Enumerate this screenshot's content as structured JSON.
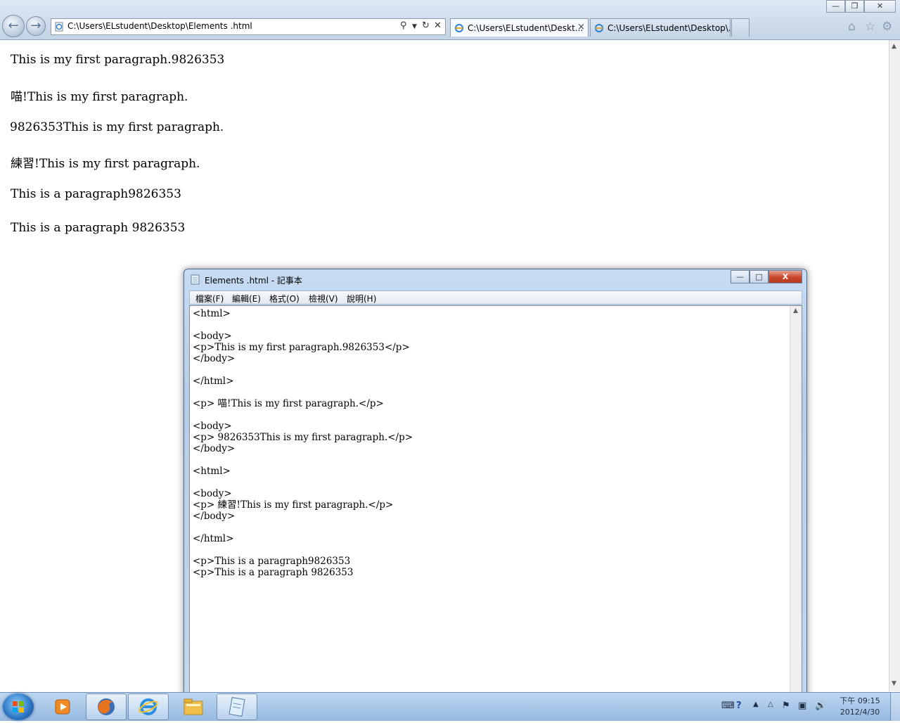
{
  "browser": {
    "address": "C:\\Users\\ELstudent\\Desktop\\Elements .html",
    "tabs": [
      {
        "label": "C:\\Users\\ELstudent\\Deskt..."
      },
      {
        "label": "C:\\Users\\ELstudent\\Desktop\\..."
      }
    ],
    "tab_close_symbol": "×",
    "toolbar_icons": [
      "home-icon",
      "favorites-star-icon",
      "tools-gear-icon"
    ],
    "window_controls": {
      "minimize": "—",
      "restore": "❐",
      "close": "✕"
    }
  },
  "page": {
    "paragraphs": [
      "This is my first paragraph.9826353",
      "喵!This is my first paragraph.",
      "9826353This is my first paragraph.",
      "練習!This is my first paragraph.",
      "This is a paragraph9826353",
      "This is a paragraph 9826353"
    ]
  },
  "notepad": {
    "title": "Elements .html - 記事本",
    "menu": [
      "檔案(F)",
      "編輯(E)",
      "格式(O)",
      "檢視(V)",
      "說明(H)"
    ],
    "window_controls": {
      "minimize": "—",
      "maximize": "□",
      "close": "X"
    },
    "content": "<html>\n\n<body>\n<p>This is my first paragraph.9826353</p>\n</body>\n\n</html>\n\n<p> 喵!This is my first paragraph.</p>\n\n<body>\n<p> 9826353This is my first paragraph.</p>\n</body>\n\n<html>\n\n<body>\n<p> 練習!This is my first paragraph.</p>\n</body>\n\n</html>\n\n<p>This is a paragraph9826353\n<p>This is a paragraph 9826353"
  },
  "taskbar": {
    "apps": [
      "media-player-icon",
      "firefox-icon",
      "internet-explorer-icon",
      "file-explorer-icon",
      "notepad-icon"
    ],
    "clock": {
      "period_time": "下午 09:15",
      "date": "2012/4/30"
    }
  }
}
